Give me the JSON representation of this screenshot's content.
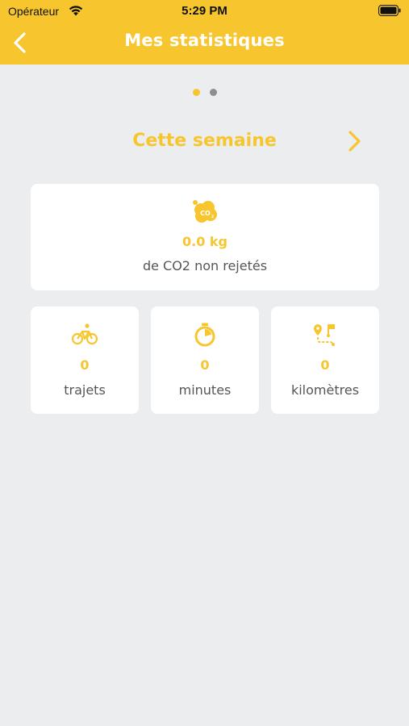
{
  "status_bar": {
    "carrier": "Opérateur",
    "time": "5:29 PM"
  },
  "nav": {
    "title": "Mes statistiques"
  },
  "pager": {
    "pages": 2,
    "active": 1
  },
  "period": {
    "label": "Cette semaine"
  },
  "co2": {
    "value": "0.0 kg",
    "label": "de CO2 non rejetés",
    "icon": "co2-cloud-icon"
  },
  "stats": [
    {
      "value": "0",
      "label": "trajets",
      "icon": "bicycle-icon"
    },
    {
      "value": "0",
      "label": "minutes",
      "icon": "stopwatch-icon"
    },
    {
      "value": "0",
      "label": "kilomètres",
      "icon": "route-icon"
    }
  ],
  "colors": {
    "accent": "#F7C62F",
    "background": "#ECEDEF",
    "card": "#FFFFFF",
    "text_muted": "#555555",
    "dot_inactive": "#8E8E8E"
  }
}
